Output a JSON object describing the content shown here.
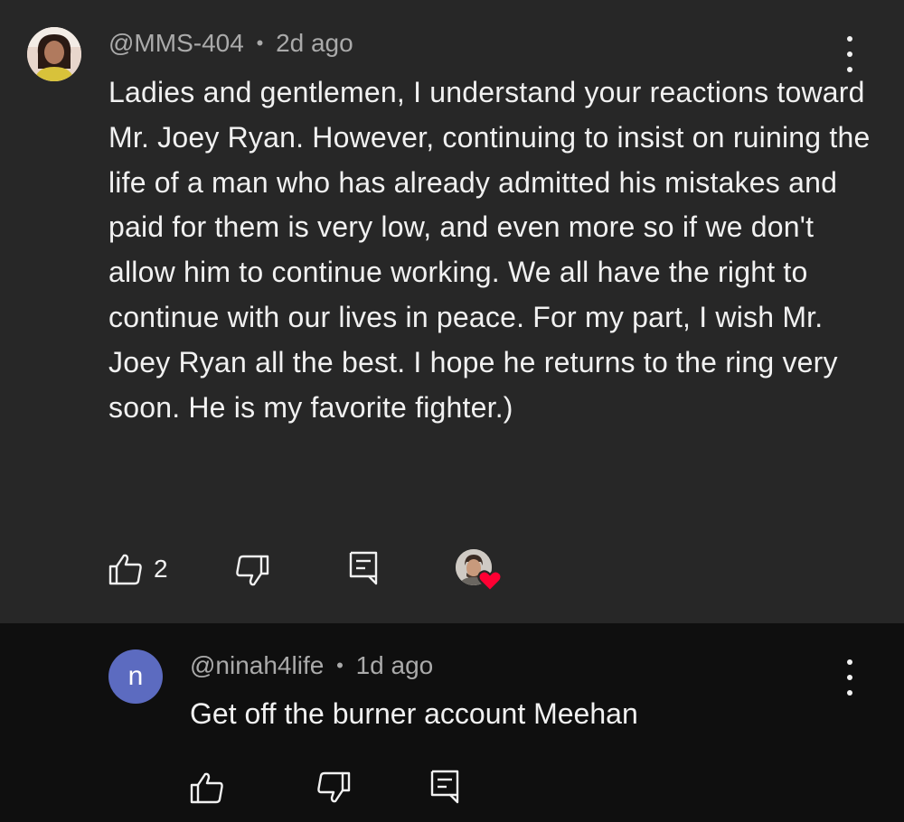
{
  "comments": [
    {
      "handle": "@MMS-404",
      "separator": "•",
      "time": "2d ago",
      "text": "Ladies and gentlemen, I understand your reactions toward Mr. Joey Ryan. However, continuing to insist on ruining the life of a man who has already admitted his mistakes and paid for them is very low, and even more so if we don't allow him to continue working. We all have the right to continue with our lives in peace. For my part, I wish Mr. Joey Ryan all the best. I hope he returns to the ring very soon. He is my favorite fighter.)",
      "like_count": "2",
      "creator_hearted": true,
      "icons": [
        "avatar",
        "thumb-up-icon",
        "thumb-down-icon",
        "reply-icon",
        "more-vert-icon",
        "heart-icon"
      ]
    },
    {
      "handle": "@ninah4life",
      "separator": "•",
      "time": "1d ago",
      "avatar_letter": "n",
      "avatar_color": "#5c6bc0",
      "text": "Get off the burner account Meehan",
      "icons": [
        "thumb-up-icon",
        "thumb-down-icon",
        "reply-icon",
        "more-vert-icon"
      ]
    }
  ],
  "colors": {
    "main_bg": "#272727",
    "reply_bg": "#0f0f0f",
    "text": "#f1f1f1",
    "meta": "#aaaaaa",
    "heart": "#ff0033"
  }
}
